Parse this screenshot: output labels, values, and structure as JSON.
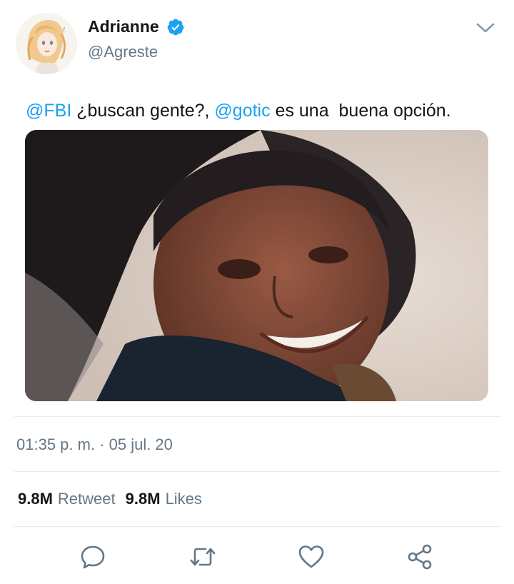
{
  "tweet": {
    "author": {
      "display_name": "Adrianne",
      "handle": "@Agreste",
      "verified": true,
      "avatar_icon": "anime-avatar"
    },
    "text_parts": {
      "mention1": "@FBI",
      "text1": " ¿buscan gente?, ",
      "mention2": "@gotic",
      "text2": " es una  buena opción."
    },
    "timestamp": "01:35 p. m. · 05 jul. 20",
    "stats": {
      "retweet_count": "9.8M",
      "retweet_label": "Retweet",
      "like_count": "9.8M",
      "like_label": "Likes"
    },
    "actions": [
      {
        "icon": "reply-icon"
      },
      {
        "icon": "retweet-icon"
      },
      {
        "icon": "like-icon"
      },
      {
        "icon": "share-icon"
      }
    ]
  },
  "colors": {
    "link": "#1da1f2",
    "secondary_text": "#657786",
    "primary_text": "#14171a",
    "divider": "#e6ecf0"
  }
}
